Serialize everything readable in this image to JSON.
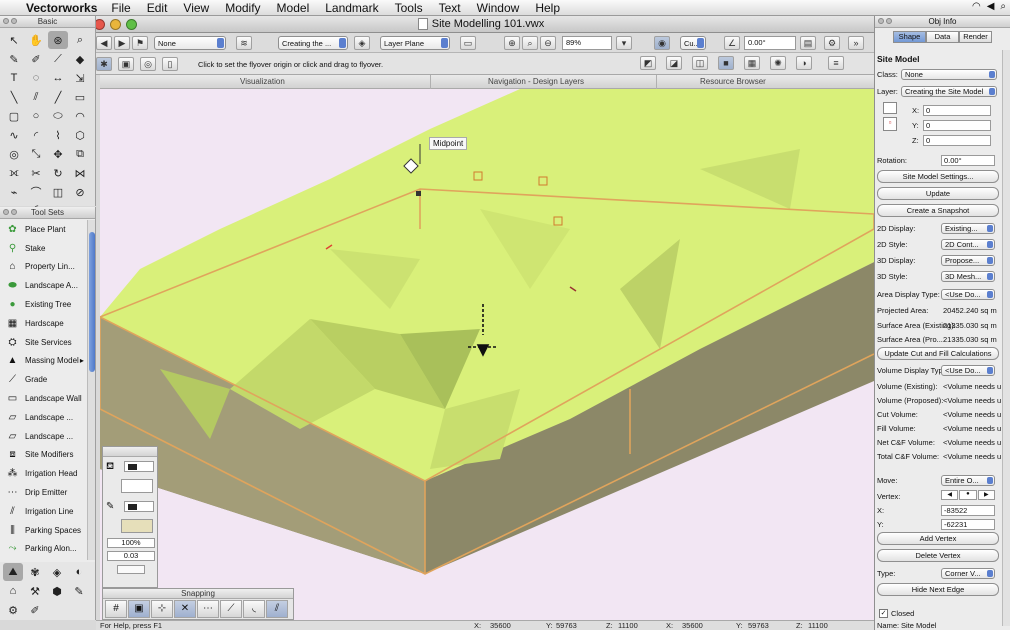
{
  "menubar": {
    "app_name": "Vectorworks",
    "items": [
      "File",
      "Edit",
      "View",
      "Modify",
      "Model",
      "Landmark",
      "Tools",
      "Text",
      "Window",
      "Help"
    ]
  },
  "window": {
    "title": "Site Modelling 101.vwx"
  },
  "toolbar": {
    "class_value": "None",
    "layer_value": "Creating the ...",
    "plane_value": "Layer Plane",
    "zoom_value": "89%",
    "view_value": "Cu...",
    "rotation_value": "0.00°"
  },
  "mode_bar": {
    "hint": "Click to set the flyover origin or click and drag to flyover."
  },
  "tabs": {
    "visualization": "Visualization",
    "navigation": "Navigation - Design Layers",
    "resource": "Resource Browser"
  },
  "canvas": {
    "snap_label": "Midpoint"
  },
  "palettes": {
    "basic_title": "Basic",
    "toolsets_title": "Tool Sets",
    "snapping_title": "Snapping"
  },
  "tool_sets": [
    {
      "label": "Place Plant",
      "icon": "plant-icon"
    },
    {
      "label": "Stake",
      "icon": "stake-icon"
    },
    {
      "label": "Property Lin...",
      "icon": "property-line-icon"
    },
    {
      "label": "Landscape A...",
      "icon": "landscape-area-icon"
    },
    {
      "label": "Existing Tree",
      "icon": "tree-icon"
    },
    {
      "label": "Hardscape",
      "icon": "hardscape-icon"
    },
    {
      "label": "Site Services",
      "icon": "site-services-icon"
    },
    {
      "label": "Massing Model",
      "icon": "massing-model-icon"
    },
    {
      "label": "Grade",
      "icon": "grade-icon"
    },
    {
      "label": "Landscape Wall",
      "icon": "landscape-wall-icon"
    },
    {
      "label": "Landscape ...",
      "icon": "landscape-icon"
    },
    {
      "label": "Landscape ...",
      "icon": "landscape-icon"
    },
    {
      "label": "Site Modifiers",
      "icon": "site-modifiers-icon"
    },
    {
      "label": "Irrigation Head",
      "icon": "irrigation-head-icon"
    },
    {
      "label": "Drip Emitter",
      "icon": "drip-emitter-icon"
    },
    {
      "label": "Irrigation Line",
      "icon": "irrigation-line-icon"
    },
    {
      "label": "Parking Spaces",
      "icon": "parking-spaces-icon"
    },
    {
      "label": "Parking Alon...",
      "icon": "parking-along-path-icon"
    }
  ],
  "attributes": {
    "opacity": "100%",
    "line_weight": "0.03"
  },
  "status": {
    "help": "For Help, press F1",
    "x_label": "X:",
    "x_value": "35600",
    "y_label": "Y:",
    "y_value": "59763",
    "z_label": "Z:",
    "z_value": "11100",
    "x2_value": "35600",
    "y2_value": "59763",
    "z2_value": "11100"
  },
  "oip": {
    "title": "Obj Info",
    "tabs": [
      "Shape",
      "Data",
      "Render"
    ],
    "object_type": "Site Model",
    "class_label": "Class:",
    "class_value": "None",
    "layer_label": "Layer:",
    "layer_value": "Creating the Site Model",
    "x_label": "X:",
    "x_value": "0",
    "y_label": "Y:",
    "y_value": "0",
    "z_label": "Z:",
    "z_value": "0",
    "rotation_label": "Rotation:",
    "rotation_value": "0.00°",
    "btn_settings": "Site Model Settings...",
    "btn_update": "Update",
    "btn_snapshot": "Create a Snapshot",
    "d2_display_label": "2D Display:",
    "d2_display_value": "Existing...",
    "d2_style_label": "2D Style:",
    "d2_style_value": "2D Cont...",
    "d3_display_label": "3D Display:",
    "d3_display_value": "Propose...",
    "d3_style_label": "3D Style:",
    "d3_style_value": "3D Mesh...",
    "area_display_label": "Area Display Type:",
    "area_display_value": "<Use Do...",
    "projected_label": "Projected Area:",
    "projected_value": "20452.240  sq m",
    "surface_existing_label": "Surface Area (Existing):",
    "surface_existing_value": "21335.030  sq m",
    "surface_proposed_label": "Surface Area (Pro...",
    "surface_proposed_value": "21335.030  sq m",
    "btn_cutfill": "Update Cut and Fill Calculations",
    "volume_display_label": "Volume Display Type:",
    "volume_display_value": "<Use Do...",
    "vol_existing_label": "Volume (Existing):",
    "vol_existing_value": "<Volume needs u",
    "vol_proposed_label": "Volume (Proposed):",
    "vol_proposed_value": "<Volume needs u",
    "cut_label": "Cut Volume:",
    "cut_value": "<Volume needs u",
    "fill_label": "Fill Volume:",
    "fill_value": "<Volume needs u",
    "net_label": "Net C&F Volume:",
    "net_value": "<Volume needs u",
    "total_label": "Total C&F Volume:",
    "total_value": "<Volume needs u",
    "move_label": "Move:",
    "move_value": "Entire O...",
    "vertex_label": "Vertex:",
    "vx_label": "X:",
    "vx_value": "-83522",
    "vy_label": "Y:",
    "vy_value": "-62231",
    "btn_add_vertex": "Add Vertex",
    "btn_delete_vertex": "Delete Vertex",
    "type_label": "Type:",
    "type_value": "Corner V...",
    "btn_hide_edge": "Hide Next Edge",
    "closed_label": "Closed",
    "name_label": "Name:",
    "name_value": "Site Model"
  },
  "colors": {
    "canvas_bg": "#f2e6f3",
    "terrain": "#d9f07a",
    "selection": "#e0a45c",
    "accent_blue": "#5b7fcf"
  }
}
